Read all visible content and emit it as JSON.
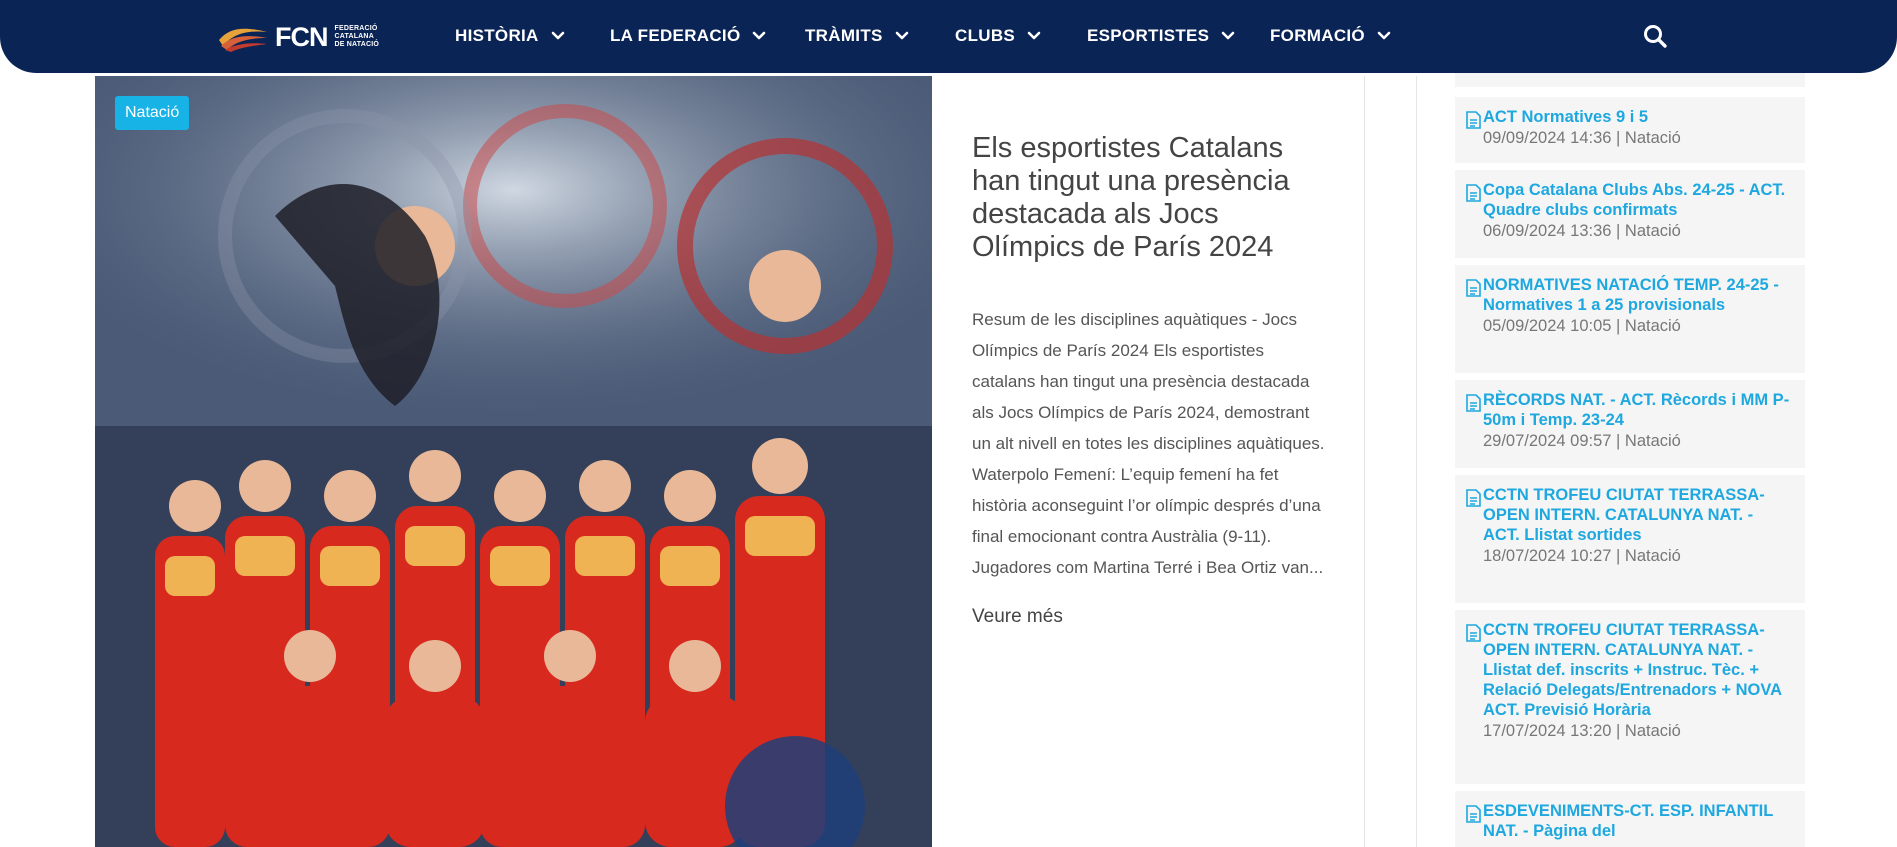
{
  "brand": {
    "name": "FCN",
    "sub_line1": "FEDERACIÓ",
    "sub_line2": "CATALANA",
    "sub_line3": "DE NATACIÓ",
    "navy": "#0b2456",
    "accent": "#17b3e6"
  },
  "nav": {
    "items": [
      {
        "label": "HISTÒRIA"
      },
      {
        "label": "LA FEDERACIÓ"
      },
      {
        "label": "TRÀMITS"
      },
      {
        "label": "CLUBS"
      },
      {
        "label": "ESPORTISTES"
      },
      {
        "label": "FORMACIÓ"
      }
    ],
    "search_icon": "search-icon"
  },
  "featured": {
    "tag": "Natació",
    "title": "Els esportistes Catalans han tingut una presència destacada als Jocs Olímpics de París 2024",
    "excerpt": "Resum de les disciplines aquàtiques - Jocs Olímpics de París 2024 Els esportistes catalans han tingut una presència destacada als Jocs Olímpics de París 2024, demostrant un alt nivell en totes les disciplines aquàtiques. Waterpolo Femení: L’equip femení ha fet història aconseguint l’or olímpic després d’una final emocionant contra Austràlia (9-11). Jugadores com Martina Terré i Bea Ortiz van...",
    "read_more": "Veure més"
  },
  "sidebar": {
    "items": [
      {
        "title": "ACT Normatives 9 i 5",
        "meta": "09/09/2024 14:36 | Natació"
      },
      {
        "title": "Copa Catalana Clubs Abs. 24-25 - ACT. Quadre clubs confirmats",
        "meta": "06/09/2024 13:36 | Natació"
      },
      {
        "title": "NORMATIVES NATACIÓ TEMP. 24-25 - Normatives 1 a 25 provisionals",
        "meta": "05/09/2024 10:05 | Natació"
      },
      {
        "title": "RÈCORDS NAT. - ACT. Rècords i MM P-50m i Temp. 23-24",
        "meta": "29/07/2024 09:57 | Natació"
      },
      {
        "title": "CCTN TROFEU CIUTAT TERRASSA-OPEN INTERN. CATALUNYA NAT. - ACT. Llistat sortides",
        "meta": "18/07/2024 10:27 | Natació"
      },
      {
        "title": "CCTN TROFEU CIUTAT TERRASSA-OPEN INTERN. CATALUNYA NAT. - Llistat def. inscrits + Instruc. Tèc. + Relació Delegats/Entrenadors + NOVA ACT. Previsió Horària",
        "meta": "17/07/2024 13:20 | Natació"
      },
      {
        "title": "ESDEVENIMENTS-CT. ESP. INFANTIL NAT. - Pàgina del",
        "meta": ""
      }
    ]
  }
}
